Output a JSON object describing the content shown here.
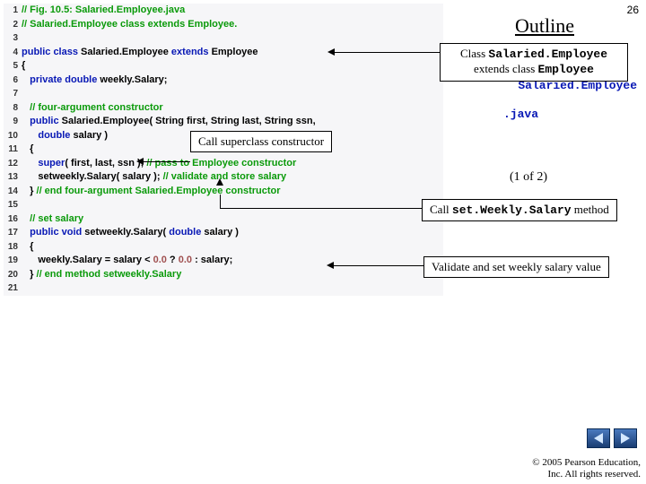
{
  "slide_number": "26",
  "outline": "Outline",
  "file_label_1": "Salaried.Employee",
  "file_label_2": ".java",
  "part_label": "(1 of  2)",
  "callouts": {
    "c1_line1": "Class ",
    "c1_mono1": "Salaried.Employee",
    "c1_line2": " extends class ",
    "c1_mono2": "Employee",
    "c2": "Call superclass constructor",
    "c3_pre": "Call ",
    "c3_mono": "set.Weekly.Salary",
    "c3_post": " method",
    "c4": "Validate and set weekly salary value"
  },
  "nav": {
    "prev": "prev",
    "next": "next"
  },
  "copyright": {
    "line1": "© 2005 Pearson Education,",
    "line2": "Inc.  All rights reserved."
  },
  "code": [
    {
      "n": "1",
      "spans": [
        [
          "com",
          "// Fig. 10.5: Salaried.Employee.java"
        ]
      ]
    },
    {
      "n": "2",
      "spans": [
        [
          "com",
          "// Salaried.Employee class extends Employee."
        ]
      ]
    },
    {
      "n": "3",
      "spans": []
    },
    {
      "n": "4",
      "spans": [
        [
          "kw",
          "public class "
        ],
        [
          "txt",
          "Salaried.Employee "
        ],
        [
          "kw",
          "extends "
        ],
        [
          "txt",
          "Employee"
        ]
      ]
    },
    {
      "n": "5",
      "spans": [
        [
          "txt",
          "{"
        ]
      ]
    },
    {
      "n": "6",
      "spans": [
        [
          "txt",
          "   "
        ],
        [
          "kw",
          "private double "
        ],
        [
          "txt",
          "weekly.Salary;"
        ]
      ]
    },
    {
      "n": "7",
      "spans": []
    },
    {
      "n": "8",
      "spans": [
        [
          "txt",
          "   "
        ],
        [
          "com",
          "// four-argument constructor"
        ]
      ]
    },
    {
      "n": "9",
      "spans": [
        [
          "txt",
          "   "
        ],
        [
          "kw",
          "public "
        ],
        [
          "txt",
          "Salaried.Employee( String first, String last, String ssn,"
        ]
      ]
    },
    {
      "n": "10",
      "spans": [
        [
          "txt",
          "      "
        ],
        [
          "kw",
          "double "
        ],
        [
          "txt",
          "salary )"
        ]
      ]
    },
    {
      "n": "11",
      "spans": [
        [
          "txt",
          "   {"
        ]
      ]
    },
    {
      "n": "12",
      "spans": [
        [
          "txt",
          "      "
        ],
        [
          "kw",
          "super"
        ],
        [
          "txt",
          "( first, last, ssn ); "
        ],
        [
          "com",
          "// pass to Employee constructor"
        ]
      ]
    },
    {
      "n": "13",
      "spans": [
        [
          "txt",
          "      setweekly.Salary( salary ); "
        ],
        [
          "com",
          "// validate and store salary"
        ]
      ]
    },
    {
      "n": "14",
      "spans": [
        [
          "txt",
          "   } "
        ],
        [
          "com",
          "// end four-argument Salaried.Employee constructor"
        ]
      ]
    },
    {
      "n": "15",
      "spans": []
    },
    {
      "n": "16",
      "spans": [
        [
          "txt",
          "   "
        ],
        [
          "com",
          "// set salary"
        ]
      ]
    },
    {
      "n": "17",
      "spans": [
        [
          "txt",
          "   "
        ],
        [
          "kw",
          "public void "
        ],
        [
          "txt",
          "setweekly.Salary( "
        ],
        [
          "kw",
          "double "
        ],
        [
          "txt",
          "salary )"
        ]
      ]
    },
    {
      "n": "18",
      "spans": [
        [
          "txt",
          "   {"
        ]
      ]
    },
    {
      "n": "19",
      "spans": [
        [
          "txt",
          "      weekly.Salary = salary < "
        ],
        [
          "num",
          "0.0"
        ],
        [
          "txt",
          " ? "
        ],
        [
          "num",
          "0.0"
        ],
        [
          "txt",
          " : salary;"
        ]
      ]
    },
    {
      "n": "20",
      "spans": [
        [
          "txt",
          "   } "
        ],
        [
          "com",
          "// end method setweekly.Salary"
        ]
      ]
    },
    {
      "n": "21",
      "spans": []
    }
  ]
}
